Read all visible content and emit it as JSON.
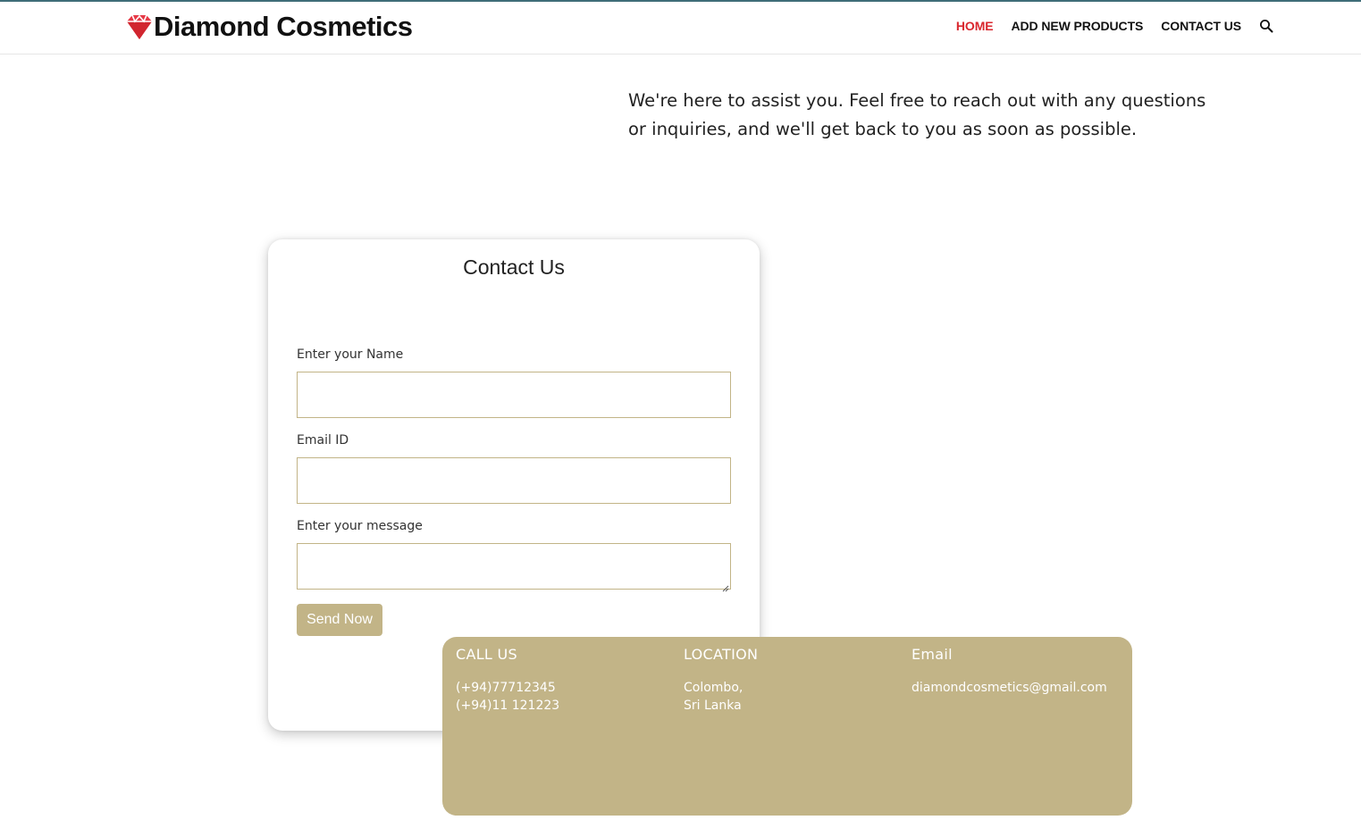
{
  "header": {
    "brand_name": "Diamond Cosmetics",
    "logo_icon": "diamond-icon",
    "nav": [
      {
        "label": "HOME",
        "active": true
      },
      {
        "label": "ADD NEW PRODUCTS",
        "active": false
      },
      {
        "label": "CONTACT US",
        "active": false
      }
    ],
    "search_icon": "search-icon"
  },
  "intro": {
    "text": "We're here to assist you. Feel free to reach out with any questions or inquiries, and we'll get back to you as soon as possible."
  },
  "contact_form": {
    "title": "Contact Us",
    "name_label": "Enter your Name",
    "name_value": "",
    "email_label": "Email ID",
    "email_value": "",
    "message_label": "Enter your message",
    "message_value": "",
    "submit_label": "Send Now"
  },
  "info": {
    "call": {
      "title": "CALL US",
      "lines": [
        "(+94)77712345",
        "(+94)11 121223"
      ]
    },
    "location": {
      "title": "LOCATION",
      "lines": [
        "Colombo,",
        "Sri Lanka"
      ]
    },
    "email": {
      "title": "Email",
      "lines": [
        "diamondcosmetics@gmail.com"
      ]
    }
  },
  "colors": {
    "accent": "#c2b487",
    "active_nav": "#d9272e",
    "logo_red": "#e63946",
    "top_line": "#3f6d78"
  }
}
